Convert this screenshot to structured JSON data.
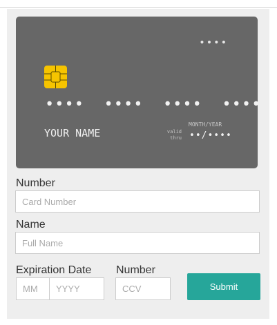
{
  "card": {
    "top_dots": "••••",
    "number_mask": "••••  ••••  ••••  ••••",
    "holder_name": "YOUR NAME",
    "valid_thru": "valid thru",
    "month_year": "MONTH/YEAR",
    "expiry_mask": "••/••••"
  },
  "form": {
    "number_label": "Number",
    "number_placeholder": "Card Number",
    "name_label": "Name",
    "name_placeholder": "Full Name",
    "expiration_label": "Expiration Date",
    "month_placeholder": "MM",
    "year_placeholder": "YYYY",
    "cvc_label": "Number",
    "cvc_placeholder": "CCV",
    "submit_label": "Submit"
  },
  "colors": {
    "card_background": "#676767",
    "chip": "#f6c400",
    "submit_button": "#26a69a",
    "panel_background": "#eeeeee"
  }
}
